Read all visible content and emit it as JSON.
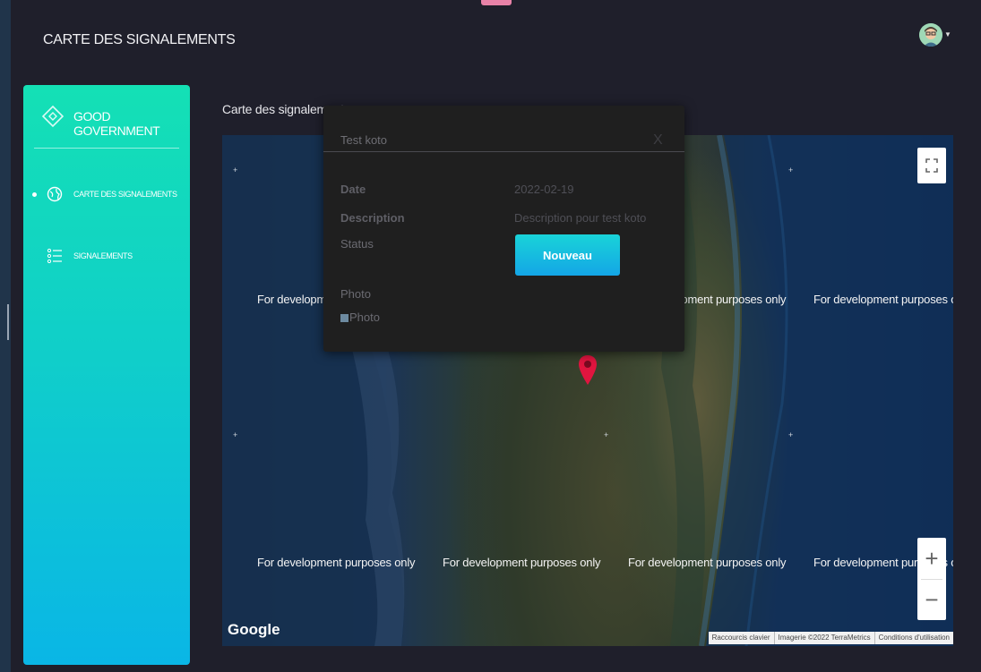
{
  "app": {
    "title": "CARTE DES SIGNALEMENTS"
  },
  "sidebar": {
    "brand": "GOOD GOVERNMENT",
    "items": [
      {
        "label": "CARTE DES SIGNALEMENTS",
        "active": true,
        "icon": "globe-icon"
      },
      {
        "label": "SIGNALEMENTS",
        "active": false,
        "icon": "list-icon"
      }
    ]
  },
  "main": {
    "section_title": "Carte des signalements"
  },
  "map": {
    "watermark": "For development purposes only",
    "zoom_in": "+",
    "zoom_out": "−",
    "provider": "Google",
    "attribution": [
      "Raccourcis clavier",
      "Imagerie ©2022 TerraMetrics",
      "Conditions d'utilisation"
    ]
  },
  "popup": {
    "title": "Test koto",
    "close": "X",
    "date_label": "Date",
    "date_value": "2022-02-19",
    "description_label": "Description",
    "description_value": "Description pour test koto",
    "status_label": "Status",
    "status_value": "Nouveau",
    "photo_label": "Photo",
    "photo_alt": "Photo"
  },
  "colors": {
    "sidebar_top": "#14e0b5",
    "sidebar_bottom": "#0ab6e6",
    "background": "#1f1f2b",
    "pin": "#e0153f"
  }
}
